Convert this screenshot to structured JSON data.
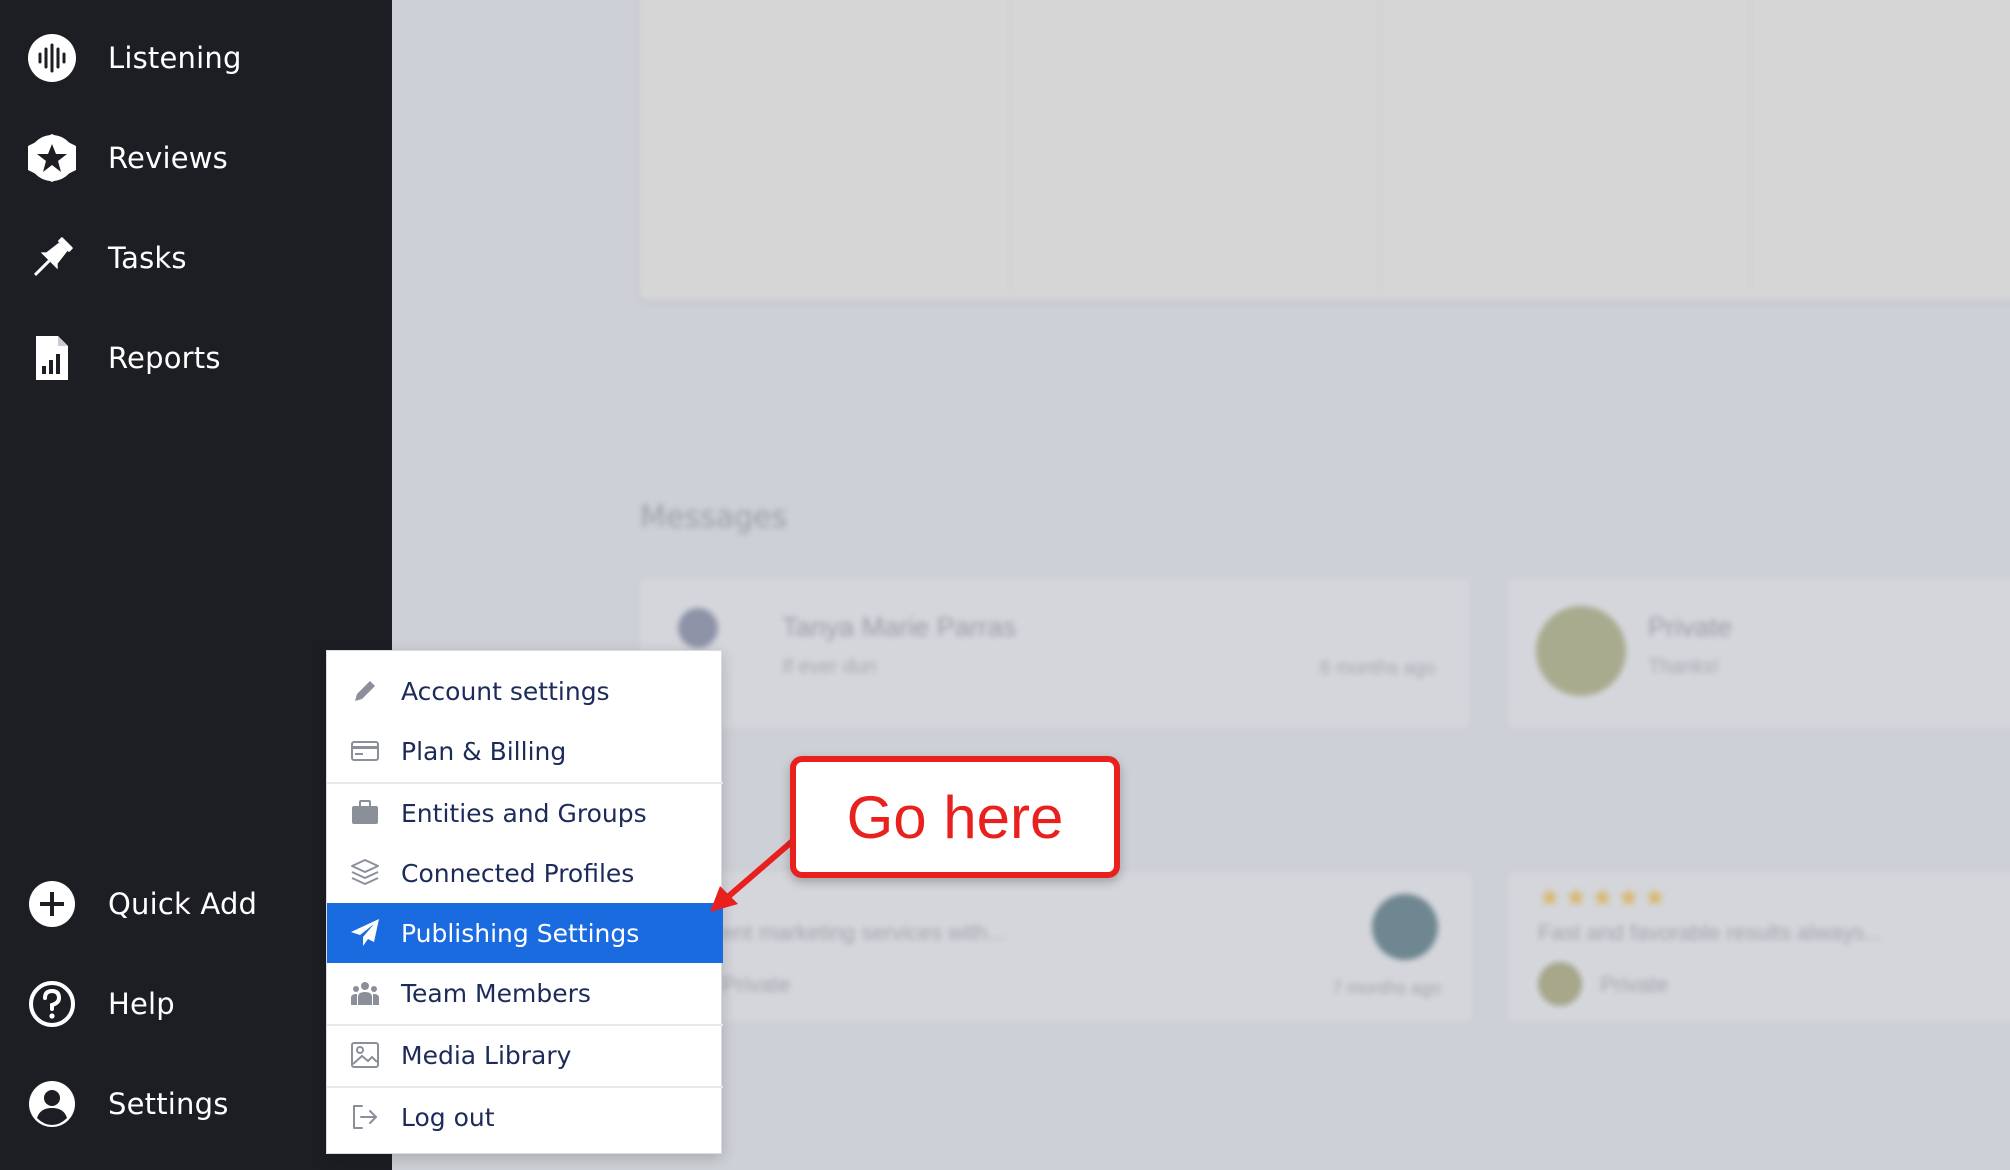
{
  "sidebar": {
    "top_items": [
      {
        "label": "Listening",
        "icon": "waveform-icon"
      },
      {
        "label": "Reviews",
        "icon": "star-badge-icon"
      },
      {
        "label": "Tasks",
        "icon": "pushpin-icon"
      },
      {
        "label": "Reports",
        "icon": "report-chart-icon"
      }
    ],
    "bottom_items": [
      {
        "label": "Quick Add",
        "icon": "plus-circle-icon"
      },
      {
        "label": "Help",
        "icon": "question-circle-icon"
      },
      {
        "label": "Settings",
        "icon": "user-circle-icon"
      }
    ]
  },
  "settings_menu": {
    "items": [
      {
        "label": "Account settings",
        "icon": "pencil-icon"
      },
      {
        "label": "Plan & Billing",
        "icon": "credit-card-icon"
      },
      {
        "label": "Entities and Groups",
        "icon": "briefcase-icon"
      },
      {
        "label": "Connected Profiles",
        "icon": "layers-icon"
      },
      {
        "label": "Publishing Settings",
        "icon": "paper-plane-icon",
        "active": true
      },
      {
        "label": "Team Members",
        "icon": "users-icon"
      },
      {
        "label": "Media Library",
        "icon": "image-icon"
      },
      {
        "label": "Log out",
        "icon": "logout-icon"
      }
    ]
  },
  "callout": {
    "text": "Go here",
    "color": "#e8211f"
  },
  "background": {
    "messages_title": "Messages",
    "message_cards": [
      {
        "name": "Tanya Marie Parras",
        "preview": "If ever dun",
        "time": "6 months ago"
      },
      {
        "name": "Private",
        "preview": "Thanks!"
      }
    ],
    "review_cards": [
      {
        "text": "ent marketing services with...",
        "author": "Private",
        "time": "7 months ago"
      },
      {
        "stars": "★★★★★",
        "text": "Fast and favorable results always...",
        "author": "Private"
      }
    ]
  },
  "colors": {
    "sidebar_bg": "#1c1e23",
    "accent": "#1a6ae0",
    "menu_text": "#1c2b5a"
  }
}
